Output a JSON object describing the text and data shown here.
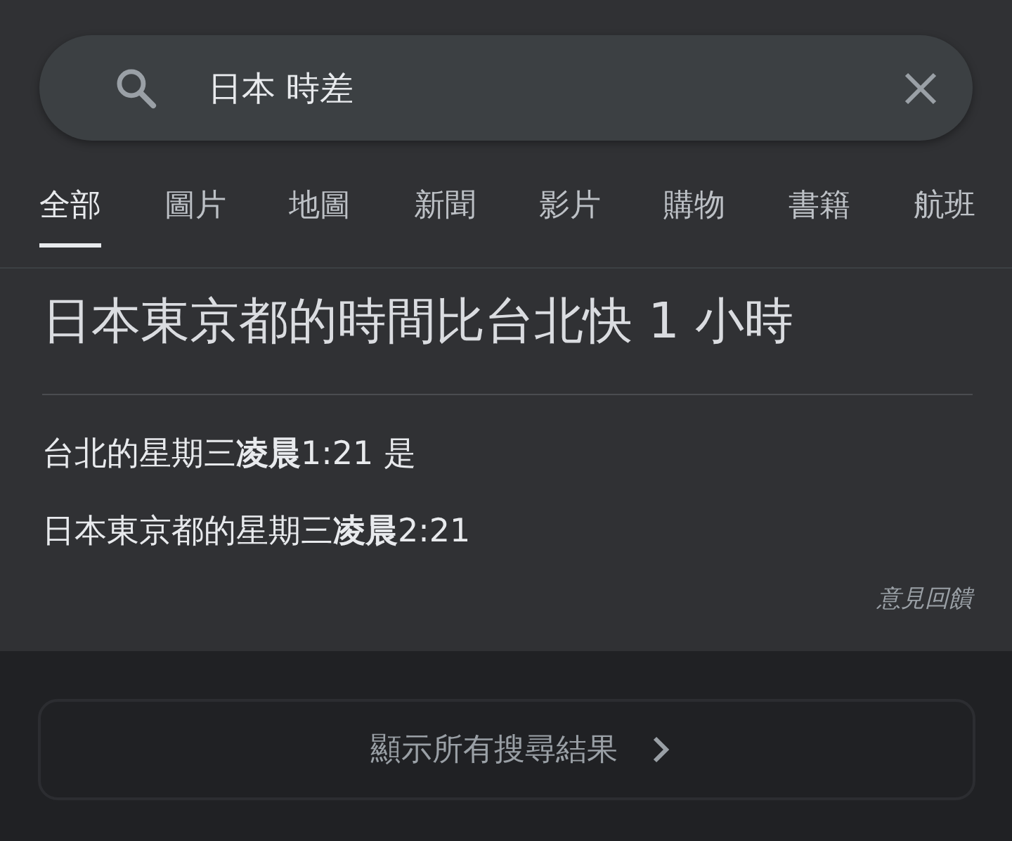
{
  "search": {
    "value": "日本 時差"
  },
  "tabs": [
    {
      "label": "全部",
      "selected": true
    },
    {
      "label": "圖片",
      "selected": false
    },
    {
      "label": "地圖",
      "selected": false
    },
    {
      "label": "新聞",
      "selected": false
    },
    {
      "label": "影片",
      "selected": false
    },
    {
      "label": "購物",
      "selected": false
    },
    {
      "label": "書籍",
      "selected": false
    },
    {
      "label": "航班",
      "selected": false
    }
  ],
  "answer": {
    "headline": "日本東京都的時間比台北快 1 小時",
    "lines": [
      "台北的星期三**凌晨**1:21 是",
      "日本東京都的星期三**凌晨**2:21"
    ],
    "feedback": "意見回饋"
  },
  "more_button": {
    "label": "顯示所有搜尋結果"
  }
}
